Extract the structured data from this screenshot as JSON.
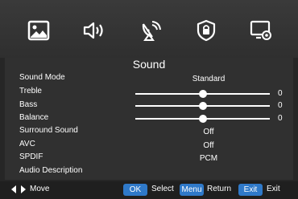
{
  "tabs": [
    {
      "icon": "picture-icon"
    },
    {
      "icon": "speaker-icon",
      "active": true
    },
    {
      "icon": "satellite-icon"
    },
    {
      "icon": "lock-icon"
    },
    {
      "icon": "settings-icon"
    }
  ],
  "menu": {
    "title": "Sound",
    "rows": [
      {
        "label": "Sound Mode",
        "value": "Standard"
      },
      {
        "label": "Treble",
        "number": "0",
        "level": 0.5
      },
      {
        "label": "Bass",
        "number": "0",
        "level": 0.5
      },
      {
        "label": "Balance",
        "number": "0",
        "level": 0.5
      },
      {
        "label": "Surround Sound",
        "value": "Off"
      },
      {
        "label": "AVC",
        "value": "Off"
      },
      {
        "label": "SPDIF",
        "value": "PCM"
      },
      {
        "label": "Audio Description"
      }
    ]
  },
  "footer": {
    "move": "Move",
    "ok_key": "OK",
    "select": "Select",
    "menu_key": "Menu",
    "return": "Return",
    "exit_key": "Exit",
    "exit": "Exit"
  },
  "colors": {
    "background": "#262626",
    "key_blue": "#2f79c9",
    "text": "#ffffff"
  }
}
